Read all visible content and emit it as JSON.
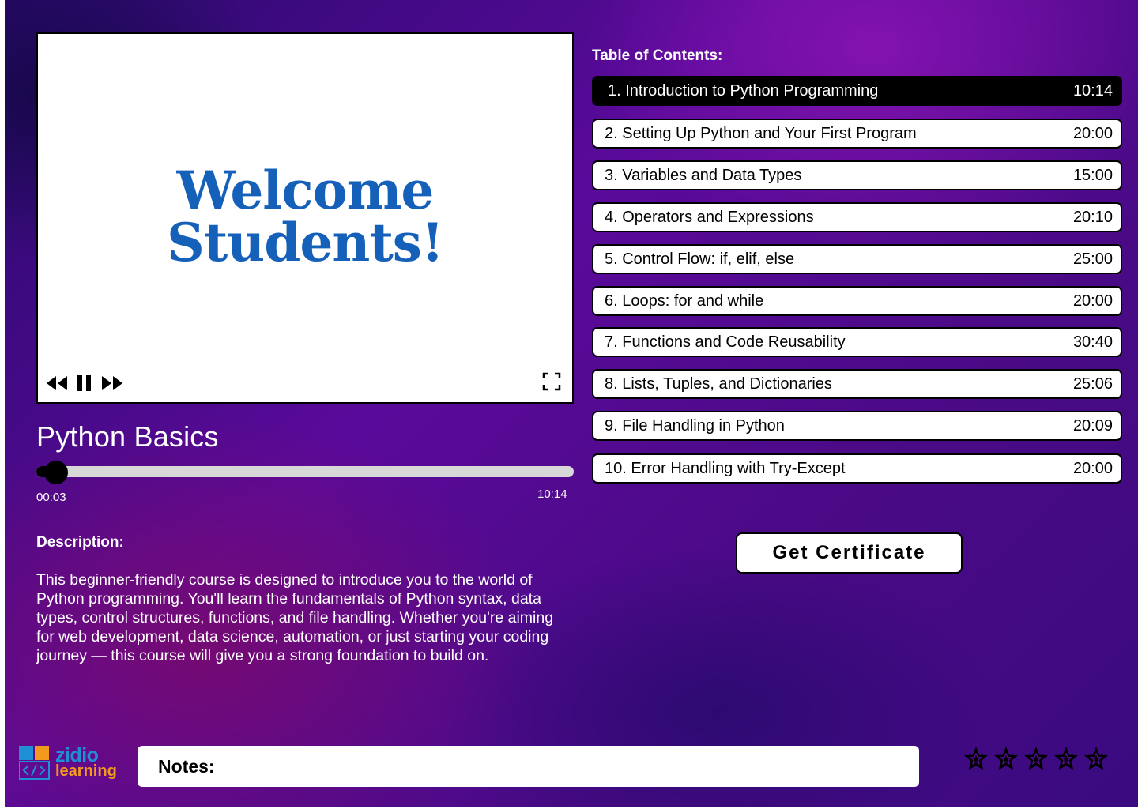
{
  "video": {
    "welcome_line1": "Welcome",
    "welcome_line2": "Students!",
    "welcome_color": "#1560b8"
  },
  "course": {
    "title": "Python Basics"
  },
  "player": {
    "current_time": "00:03",
    "total_time": "10:14",
    "progress_fraction": 0.005
  },
  "description": {
    "label": "Description:",
    "text": "This beginner-friendly course is designed to introduce you to the world of Python programming. You'll learn the fundamentals of Python syntax, data types, control structures, functions, and file handling. Whether you're aiming for web development, data science, automation, or just starting your coding journey — this course will give you a strong foundation to build on."
  },
  "toc": {
    "label": "Table of Contents:",
    "items": [
      {
        "label": "1. Introduction to Python Programming",
        "duration": "10:14",
        "active": true
      },
      {
        "label": "2. Setting Up Python and Your First Program",
        "duration": "20:00",
        "active": false
      },
      {
        "label": "3. Variables and Data Types",
        "duration": "15:00",
        "active": false
      },
      {
        "label": "4. Operators and Expressions",
        "duration": "20:10",
        "active": false
      },
      {
        "label": "5. Control Flow: if, elif, else",
        "duration": "25:00",
        "active": false
      },
      {
        "label": "6. Loops: for and while",
        "duration": "20:00",
        "active": false
      },
      {
        "label": "7. Functions and Code Reusability",
        "duration": "30:40",
        "active": false
      },
      {
        "label": "8. Lists, Tuples, and Dictionaries",
        "duration": "25:06",
        "active": false
      },
      {
        "label": "9. File Handling in Python",
        "duration": "20:09",
        "active": false
      },
      {
        "label": "10. Error Handling with Try-Except",
        "duration": "20:00",
        "active": false
      }
    ]
  },
  "certificate": {
    "button_label": "Get Certificate"
  },
  "logo": {
    "line1": "zidio",
    "line2": "learning"
  },
  "notes": {
    "label": "Notes:"
  },
  "rating": {
    "max": 5,
    "value": 0
  },
  "colors": {
    "accent": "#000000",
    "logo_blue": "#1f8fd6",
    "logo_orange": "#f29a1e"
  },
  "icons": [
    "rewind-icon",
    "pause-icon",
    "fast-forward-icon",
    "fullscreen-icon",
    "star-icon"
  ]
}
